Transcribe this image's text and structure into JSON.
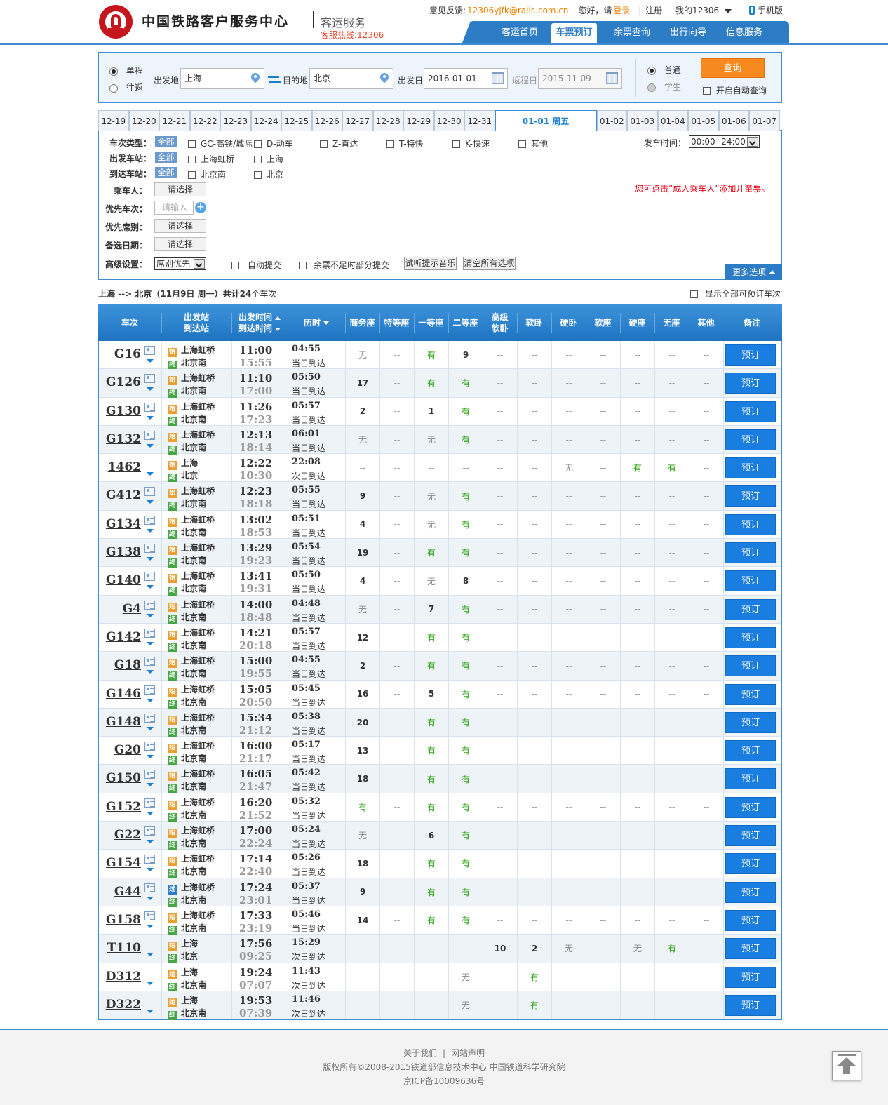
{
  "header": {
    "site_title": "中国铁路客户服务中心",
    "sub_title": "客运服务",
    "hotline": "客服热线:12306",
    "feedback_label": "意见反馈:",
    "feedback_mail": "12306yjfk@rails.com.cn",
    "greeting": "您好，请",
    "login": "登录",
    "register": "注册",
    "my12306": "我的12306",
    "mobile": "手机版",
    "nav": [
      "客运首页",
      "车票预订",
      "余票查询",
      "出行向导",
      "信息服务"
    ]
  },
  "search": {
    "single": "单程",
    "round": "往返",
    "from_label": "出发地",
    "from_value": "上海",
    "to_label": "目的地",
    "to_value": "北京",
    "date_label": "出发日",
    "date_value": "2016-01-01",
    "return_label": "返程日",
    "return_value": "2015-11-09",
    "normal": "普通",
    "student": "学生",
    "query": "查询",
    "auto_query": "开启自动查询"
  },
  "date_tabs": [
    "12-19",
    "12-20",
    "12-21",
    "12-22",
    "12-23",
    "12-24",
    "12-25",
    "12-26",
    "12-27",
    "12-28",
    "12-29",
    "12-30",
    "12-31",
    "01-01 周五",
    "01-02",
    "01-03",
    "01-04",
    "01-05",
    "01-06",
    "01-07"
  ],
  "filter": {
    "type_label": "车次类型：",
    "from_label": "出发车站：",
    "to_label": "到达车站：",
    "passenger_label": "乘车人：",
    "priority_train_label": "优先车次：",
    "priority_seat_label": "优先席别：",
    "alt_date_label": "备选日期：",
    "advanced_label": "高级设置：",
    "all": "全部",
    "types": [
      "GC-高铁/城际",
      "D-动车",
      "Z-直达",
      "T-特快",
      "K-快速",
      "其他"
    ],
    "from_stations": [
      "上海虹桥",
      "上海"
    ],
    "to_stations": [
      "北京南",
      "北京"
    ],
    "choose": "请选择",
    "input_placeholder": "请输入",
    "depart_time_label": "发车时间：",
    "depart_time_value": "00:00--24:00",
    "advanced_value": "席别优先",
    "auto_submit": "自动提交",
    "partial_submit": "余票不足时部分提交",
    "try_music": "试听提示音乐",
    "clear_all": "清空所有选项",
    "child_tip": "您可点击“成人乘车人”添加儿童票。",
    "more": "更多选项"
  },
  "summary": {
    "route": "上海 --> 北京（11月9日  周一）共计",
    "count": "24",
    "suffix": "个车次",
    "show_all": "显示全部可预订车次"
  },
  "table_head": {
    "train": "车次",
    "station_1": "出发站",
    "station_2": "到达站",
    "time_1": "出发时间",
    "time_2": "到达时间",
    "duration": "历时",
    "seats": [
      "商务座",
      "特等座",
      "一等座",
      "二等座",
      "高级\n软卧",
      "软卧",
      "硬卧",
      "软座",
      "硬座",
      "无座",
      "其他"
    ],
    "remark": "备注"
  },
  "book_label": "预订",
  "trains": [
    {
      "no": "G16",
      "from": "上海虹桥",
      "to": "北京南",
      "fi": "始",
      "ti": "终",
      "dep": "11:00",
      "arr": "15:55",
      "dur": "04:55",
      "day": "当日到达",
      "seats": [
        "无",
        "--",
        "有",
        "9",
        "--",
        "--",
        "--",
        "--",
        "--",
        "--",
        "--"
      ]
    },
    {
      "no": "G126",
      "from": "上海虹桥",
      "to": "北京南",
      "fi": "始",
      "ti": "终",
      "dep": "11:10",
      "arr": "17:00",
      "dur": "05:50",
      "day": "当日到达",
      "seats": [
        "17",
        "--",
        "有",
        "有",
        "--",
        "--",
        "--",
        "--",
        "--",
        "--",
        "--"
      ]
    },
    {
      "no": "G130",
      "from": "上海虹桥",
      "to": "北京南",
      "fi": "始",
      "ti": "终",
      "dep": "11:26",
      "arr": "17:23",
      "dur": "05:57",
      "day": "当日到达",
      "seats": [
        "2",
        "--",
        "1",
        "有",
        "--",
        "--",
        "--",
        "--",
        "--",
        "--",
        "--"
      ]
    },
    {
      "no": "G132",
      "from": "上海虹桥",
      "to": "北京南",
      "fi": "始",
      "ti": "终",
      "dep": "12:13",
      "arr": "18:14",
      "dur": "06:01",
      "day": "当日到达",
      "seats": [
        "无",
        "--",
        "无",
        "有",
        "--",
        "--",
        "--",
        "--",
        "--",
        "--",
        "--"
      ]
    },
    {
      "no": "1462",
      "from": "上海",
      "to": "北京",
      "fi": "始",
      "ti": "终",
      "dep": "12:22",
      "arr": "10:30",
      "dur": "22:08",
      "day": "次日到达",
      "seats": [
        "--",
        "--",
        "--",
        "--",
        "--",
        "--",
        "无",
        "--",
        "有",
        "有",
        "--"
      ]
    },
    {
      "no": "G412",
      "from": "上海虹桥",
      "to": "北京南",
      "fi": "始",
      "ti": "终",
      "dep": "12:23",
      "arr": "18:18",
      "dur": "05:55",
      "day": "当日到达",
      "seats": [
        "9",
        "--",
        "无",
        "有",
        "--",
        "--",
        "--",
        "--",
        "--",
        "--",
        "--"
      ]
    },
    {
      "no": "G134",
      "from": "上海虹桥",
      "to": "北京南",
      "fi": "始",
      "ti": "终",
      "dep": "13:02",
      "arr": "18:53",
      "dur": "05:51",
      "day": "当日到达",
      "seats": [
        "4",
        "--",
        "无",
        "有",
        "--",
        "--",
        "--",
        "--",
        "--",
        "--",
        "--"
      ]
    },
    {
      "no": "G138",
      "from": "上海虹桥",
      "to": "北京南",
      "fi": "始",
      "ti": "终",
      "dep": "13:29",
      "arr": "19:23",
      "dur": "05:54",
      "day": "当日到达",
      "seats": [
        "19",
        "--",
        "有",
        "有",
        "--",
        "--",
        "--",
        "--",
        "--",
        "--",
        "--"
      ]
    },
    {
      "no": "G140",
      "from": "上海虹桥",
      "to": "北京南",
      "fi": "始",
      "ti": "终",
      "dep": "13:41",
      "arr": "19:31",
      "dur": "05:50",
      "day": "当日到达",
      "seats": [
        "4",
        "--",
        "无",
        "8",
        "--",
        "--",
        "--",
        "--",
        "--",
        "--",
        "--"
      ]
    },
    {
      "no": "G4",
      "from": "上海虹桥",
      "to": "北京南",
      "fi": "始",
      "ti": "终",
      "dep": "14:00",
      "arr": "18:48",
      "dur": "04:48",
      "day": "当日到达",
      "seats": [
        "无",
        "--",
        "7",
        "有",
        "--",
        "--",
        "--",
        "--",
        "--",
        "--",
        "--"
      ]
    },
    {
      "no": "G142",
      "from": "上海虹桥",
      "to": "北京南",
      "fi": "始",
      "ti": "终",
      "dep": "14:21",
      "arr": "20:18",
      "dur": "05:57",
      "day": "当日到达",
      "seats": [
        "12",
        "--",
        "有",
        "有",
        "--",
        "--",
        "--",
        "--",
        "--",
        "--",
        "--"
      ]
    },
    {
      "no": "G18",
      "from": "上海虹桥",
      "to": "北京南",
      "fi": "始",
      "ti": "终",
      "dep": "15:00",
      "arr": "19:55",
      "dur": "04:55",
      "day": "当日到达",
      "seats": [
        "2",
        "--",
        "有",
        "有",
        "--",
        "--",
        "--",
        "--",
        "--",
        "--",
        "--"
      ]
    },
    {
      "no": "G146",
      "from": "上海虹桥",
      "to": "北京南",
      "fi": "始",
      "ti": "终",
      "dep": "15:05",
      "arr": "20:50",
      "dur": "05:45",
      "day": "当日到达",
      "seats": [
        "16",
        "--",
        "5",
        "有",
        "--",
        "--",
        "--",
        "--",
        "--",
        "--",
        "--"
      ]
    },
    {
      "no": "G148",
      "from": "上海虹桥",
      "to": "北京南",
      "fi": "始",
      "ti": "终",
      "dep": "15:34",
      "arr": "21:12",
      "dur": "05:38",
      "day": "当日到达",
      "seats": [
        "20",
        "--",
        "有",
        "有",
        "--",
        "--",
        "--",
        "--",
        "--",
        "--",
        "--"
      ]
    },
    {
      "no": "G20",
      "from": "上海虹桥",
      "to": "北京南",
      "fi": "始",
      "ti": "终",
      "dep": "16:00",
      "arr": "21:17",
      "dur": "05:17",
      "day": "当日到达",
      "seats": [
        "13",
        "--",
        "有",
        "有",
        "--",
        "--",
        "--",
        "--",
        "--",
        "--",
        "--"
      ]
    },
    {
      "no": "G150",
      "from": "上海虹桥",
      "to": "北京南",
      "fi": "始",
      "ti": "终",
      "dep": "16:05",
      "arr": "21:47",
      "dur": "05:42",
      "day": "当日到达",
      "seats": [
        "18",
        "--",
        "有",
        "有",
        "--",
        "--",
        "--",
        "--",
        "--",
        "--",
        "--"
      ]
    },
    {
      "no": "G152",
      "from": "上海虹桥",
      "to": "北京南",
      "fi": "始",
      "ti": "终",
      "dep": "16:20",
      "arr": "21:52",
      "dur": "05:32",
      "day": "当日到达",
      "seats": [
        "有",
        "--",
        "有",
        "有",
        "--",
        "--",
        "--",
        "--",
        "--",
        "--",
        "--"
      ]
    },
    {
      "no": "G22",
      "from": "上海虹桥",
      "to": "北京南",
      "fi": "始",
      "ti": "终",
      "dep": "17:00",
      "arr": "22:24",
      "dur": "05:24",
      "day": "当日到达",
      "seats": [
        "无",
        "--",
        "6",
        "有",
        "--",
        "--",
        "--",
        "--",
        "--",
        "--",
        "--"
      ]
    },
    {
      "no": "G154",
      "from": "上海虹桥",
      "to": "北京南",
      "fi": "始",
      "ti": "终",
      "dep": "17:14",
      "arr": "22:40",
      "dur": "05:26",
      "day": "当日到达",
      "seats": [
        "18",
        "--",
        "有",
        "有",
        "--",
        "--",
        "--",
        "--",
        "--",
        "--",
        "--"
      ]
    },
    {
      "no": "G44",
      "from": "上海虹桥",
      "to": "北京南",
      "fi": "过",
      "ti": "终",
      "dep": "17:24",
      "arr": "23:01",
      "dur": "05:37",
      "day": "当日到达",
      "seats": [
        "9",
        "--",
        "有",
        "有",
        "--",
        "--",
        "--",
        "--",
        "--",
        "--",
        "--"
      ]
    },
    {
      "no": "G158",
      "from": "上海虹桥",
      "to": "北京南",
      "fi": "始",
      "ti": "终",
      "dep": "17:33",
      "arr": "23:19",
      "dur": "05:46",
      "day": "当日到达",
      "seats": [
        "14",
        "--",
        "有",
        "有",
        "--",
        "--",
        "--",
        "--",
        "--",
        "--",
        "--"
      ]
    },
    {
      "no": "T110",
      "from": "上海",
      "to": "北京",
      "fi": "始",
      "ti": "终",
      "dep": "17:56",
      "arr": "09:25",
      "dur": "15:29",
      "day": "次日到达",
      "seats": [
        "--",
        "--",
        "--",
        "--",
        "10",
        "2",
        "无",
        "--",
        "无",
        "有",
        "--"
      ]
    },
    {
      "no": "D312",
      "from": "上海",
      "to": "北京南",
      "fi": "始",
      "ti": "终",
      "dep": "19:24",
      "arr": "07:07",
      "dur": "11:43",
      "day": "次日到达",
      "seats": [
        "--",
        "--",
        "--",
        "无",
        "--",
        "有",
        "--",
        "--",
        "--",
        "--",
        "--"
      ]
    },
    {
      "no": "D322",
      "from": "上海",
      "to": "北京南",
      "fi": "始",
      "ti": "终",
      "dep": "19:53",
      "arr": "07:39",
      "dur": "11:46",
      "day": "次日到达",
      "seats": [
        "--",
        "--",
        "--",
        "无",
        "--",
        "有",
        "--",
        "--",
        "--",
        "--",
        "--"
      ]
    }
  ],
  "footer": {
    "about": "关于我们",
    "statement": "网站声明",
    "copyright": "版权所有©2008-2015铁道部信息技术中心  中国铁道科学研究院",
    "icp": "京ICP备10009636号"
  }
}
